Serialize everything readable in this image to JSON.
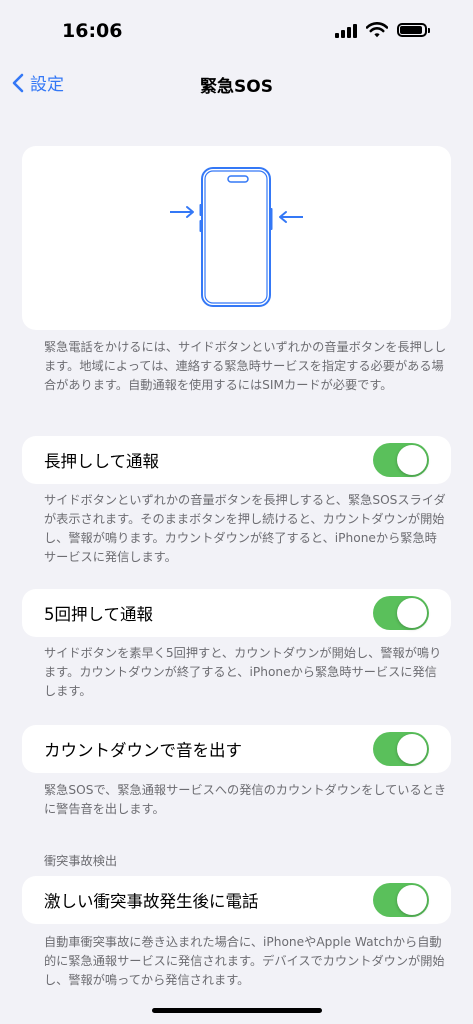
{
  "status": {
    "time": "16:06"
  },
  "nav": {
    "back_label": "設定",
    "title": "緊急SOS"
  },
  "intro_note": "緊急電話をかけるには、サイドボタンといずれかの音量ボタンを長押しします。地域によっては、連絡する緊急時サービスを指定する必要がある場合があります。自動通報を使用するにはSIMカードが必要です。",
  "settings": [
    {
      "label": "長押しして通報",
      "on": true,
      "note": "サイドボタンといずれかの音量ボタンを長押しすると、緊急SOSスライダが表示されます。そのままボタンを押し続けると、カウントダウンが開始し、警報が鳴ります。カウントダウンが終了すると、iPhoneから緊急時サービスに発信します。"
    },
    {
      "label": "5回押して通報",
      "on": true,
      "note": "サイドボタンを素早く5回押すと、カウントダウンが開始し、警報が鳴ります。カウントダウンが終了すると、iPhoneから緊急時サービスに発信します。"
    },
    {
      "label": "カウントダウンで音を出す",
      "on": true,
      "note": "緊急SOSで、緊急通報サービスへの発信のカウントダウンをしているときに警告音を出します。"
    }
  ],
  "crash": {
    "header": "衝突事故検出",
    "label": "激しい衝突事故発生後に電話",
    "on": true,
    "note": "自動車衝突事故に巻き込まれた場合に、iPhoneやApple Watchから自動的に緊急通報サービスに発信されます。デバイスでカウントダウンが開始し、警報が鳴ってから発信されます。"
  },
  "colors": {
    "accent": "#3478f6",
    "toggle_on": "#5ac05b",
    "background": "#f2f2f7"
  }
}
